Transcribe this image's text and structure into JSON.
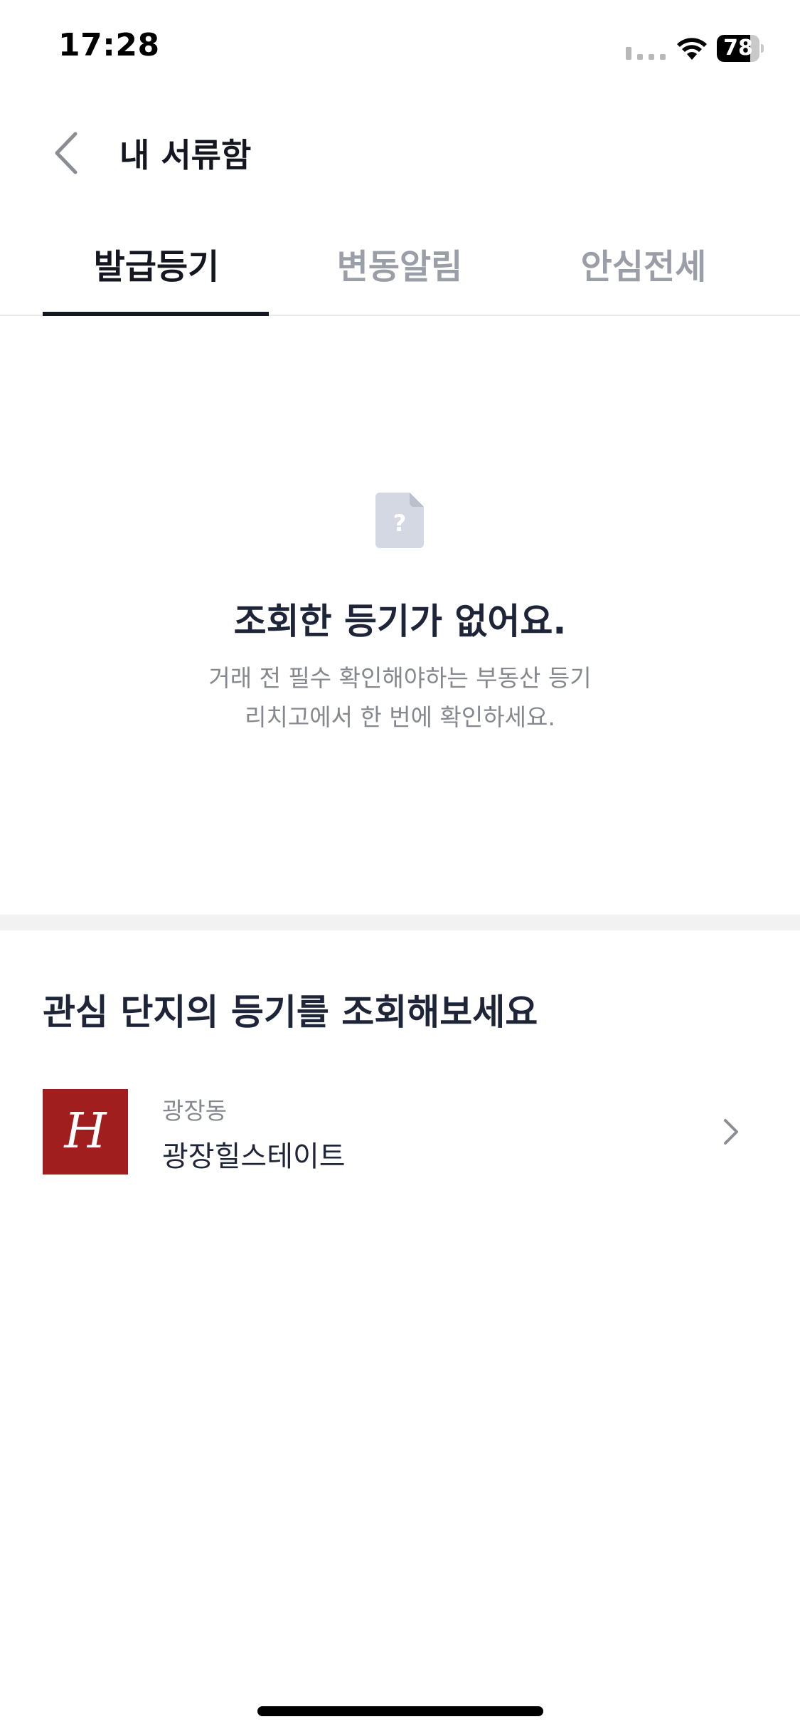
{
  "status_bar": {
    "time": "17:28",
    "battery_level": "78",
    "battery_fraction": 0.78
  },
  "header": {
    "back_icon": "chevron-left-icon",
    "title": "내 서류함"
  },
  "tabs": [
    {
      "label": "발급등기",
      "active": true
    },
    {
      "label": "변동알림",
      "active": false
    },
    {
      "label": "안심전세",
      "active": false
    }
  ],
  "empty_state": {
    "icon": "document-question-icon",
    "icon_glyph": "?",
    "title": "조회한 등기가 없어요.",
    "description_lines": [
      "거래 전 필수 확인해야하는 부동산 등기",
      "리치고에서 한 번에 확인하세요."
    ]
  },
  "interest_section": {
    "title": "관심 단지의 등기를 조회해보세요",
    "items": [
      {
        "region": "광장동",
        "name": "광장힐스테이트",
        "logo_letter": "H",
        "logo_color": "#a01e1e"
      }
    ]
  },
  "colors": {
    "text_primary": "#1e2538",
    "text_secondary": "#85898f",
    "tab_inactive": "#9a9ea6",
    "divider": "#e8e8ea",
    "icon_gray": "#d3d8e3"
  }
}
